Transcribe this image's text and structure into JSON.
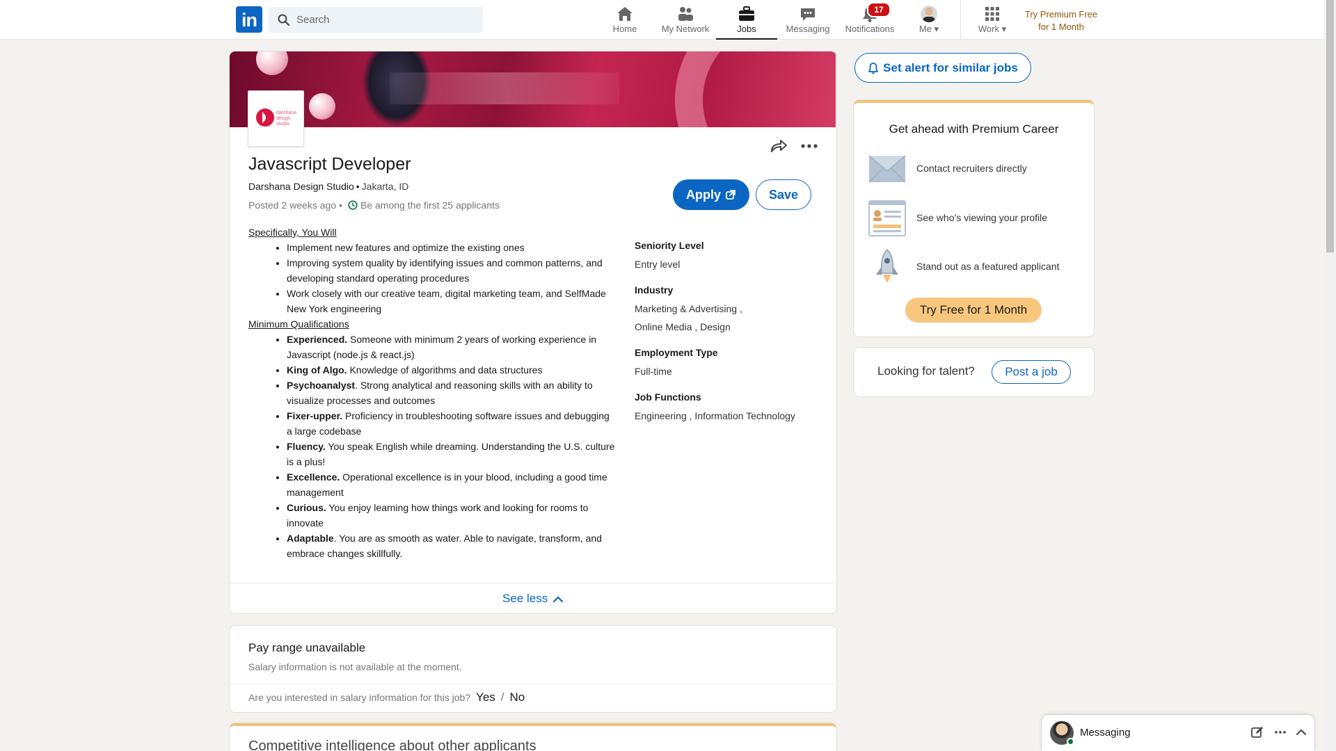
{
  "nav": {
    "logo_text": "in",
    "search_placeholder": "Search",
    "items": [
      {
        "label": "Home",
        "icon": "home-icon"
      },
      {
        "label": "My Network",
        "icon": "people-icon"
      },
      {
        "label": "Jobs",
        "icon": "briefcase-icon",
        "active": true
      },
      {
        "label": "Messaging",
        "icon": "chat-icon"
      },
      {
        "label": "Notifications",
        "icon": "bell-icon",
        "badge": "17"
      },
      {
        "label": "Me",
        "icon": "avatar"
      },
      {
        "label": "Work",
        "icon": "grid-icon"
      }
    ],
    "premium_line1": "Try Premium Free",
    "premium_line2": "for 1 Month"
  },
  "job": {
    "company_logo_text": "darshana design studio",
    "title": "Javascript Developer",
    "company": "Darshana Design Studio",
    "location": "Jakarta, ID",
    "posted": "Posted 2 weeks ago",
    "applicants": "Be among the first 25 applicants",
    "apply_label": "Apply",
    "save_label": "Save",
    "description": {
      "section1_title": "Specifically, You Will",
      "section1_items": [
        "Implement new features and optimize the existing ones",
        "Improving system quality by identifying issues and common patterns, and developing standard operating procedures",
        "Work closely with our creative team, digital marketing team, and SelfMade New York engineering"
      ],
      "section2_title": "Minimum Qualifications",
      "section2_items": [
        {
          "bold": "Experienced.",
          "text": " Someone with minimum 2 years of working experience in Javascript (node.js & react.js)"
        },
        {
          "bold": "King of Algo.",
          "text": " Knowledge of algorithms and data structures"
        },
        {
          "bold": "Psychoanalyst",
          "text": ". Strong analytical and reasoning skills with an ability to visualize processes and outcomes"
        },
        {
          "bold": "Fixer-upper.",
          "text": " Proficiency in troubleshooting software issues and debugging a large codebase"
        },
        {
          "bold": "Fluency.",
          "text": " You speak English while dreaming. Understanding the U.S. culture is a plus!"
        },
        {
          "bold": "Excellence.",
          "text": " Operational excellence is in your blood, including a good time management"
        },
        {
          "bold": "Curious.",
          "text": " You enjoy learning how things work and looking for rooms to innovate"
        },
        {
          "bold": "Adaptable",
          "text": ". You are as smooth as water. Able to navigate, transform, and embrace changes skillfully."
        }
      ]
    },
    "criteria": [
      {
        "label": "Seniority Level",
        "value_lines": [
          "Entry level"
        ]
      },
      {
        "label": "Industry",
        "value_lines": [
          "Marketing & Advertising ,",
          "Online Media , Design"
        ]
      },
      {
        "label": "Employment Type",
        "value_lines": [
          "Full-time"
        ]
      },
      {
        "label": "Job Functions",
        "value_lines": [
          "Engineering , Information Technology"
        ]
      }
    ],
    "see_less_label": "See less"
  },
  "pay": {
    "title": "Pay range unavailable",
    "subtitle": "Salary information is not available at the moment.",
    "question": "Are you interested in salary information for this job?",
    "yes": "Yes",
    "slash": "/",
    "no": "No"
  },
  "competitive": {
    "title": "Competitive intelligence about other applicants"
  },
  "sidebar": {
    "alert_label": "Set alert for similar jobs",
    "premium": {
      "title": "Get ahead with Premium Career",
      "perks": [
        {
          "icon": "envelope-icon",
          "text": "Contact recruiters directly"
        },
        {
          "icon": "profile-card-icon",
          "text": "See who’s viewing your profile"
        },
        {
          "icon": "rocket-icon",
          "text": "Stand out as a featured applicant"
        }
      ],
      "cta": "Try Free for 1 Month"
    },
    "talent": {
      "text": "Looking for talent?",
      "cta": "Post a job"
    }
  },
  "messaging": {
    "label": "Messaging"
  },
  "colors": {
    "brand": "#0a66c2",
    "premium_gold": "#f8c77e",
    "notification_red": "#cc1016",
    "banner": "#b01a44"
  }
}
